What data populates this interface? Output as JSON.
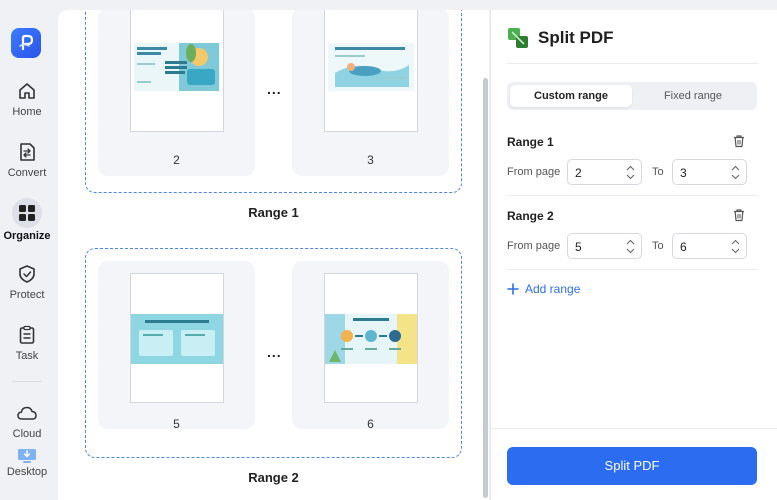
{
  "sidebar": {
    "items": [
      {
        "label": "Home"
      },
      {
        "label": "Convert"
      },
      {
        "label": "Organize"
      },
      {
        "label": "Protect"
      },
      {
        "label": "Task"
      },
      {
        "label": "Cloud"
      },
      {
        "label": "Desktop"
      }
    ]
  },
  "main": {
    "groups": [
      {
        "label": "Range 1",
        "pages": [
          "2",
          "3"
        ]
      },
      {
        "label": "Range 2",
        "pages": [
          "5",
          "6"
        ]
      }
    ],
    "ellipsis": "..."
  },
  "panel": {
    "title": "Split PDF",
    "tabs": [
      {
        "label": "Custom range",
        "active": true
      },
      {
        "label": "Fixed range",
        "active": false
      }
    ],
    "ranges": [
      {
        "title": "Range 1",
        "from_label": "From page",
        "from": "2",
        "to_label": "To",
        "to": "3"
      },
      {
        "title": "Range 2",
        "from_label": "From page",
        "from": "5",
        "to_label": "To",
        "to": "6"
      }
    ],
    "add_range": "Add range",
    "split_button": "Split PDF"
  },
  "colors": {
    "accent": "#2b6cf0",
    "dashed_border": "#4f86e6"
  }
}
